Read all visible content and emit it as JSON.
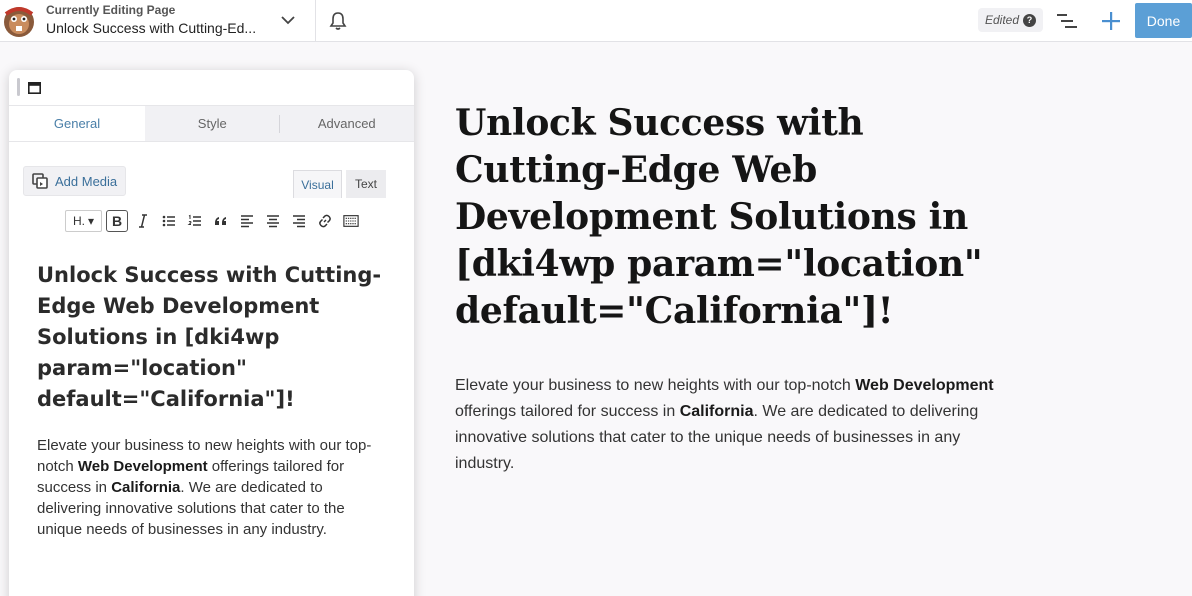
{
  "header": {
    "subtitle": "Currently Editing Page",
    "page_title": "Unlock Success with Cutting-Ed...",
    "edited_label": "Edited",
    "done_label": "Done"
  },
  "panel": {
    "tabs": [
      {
        "label": "General",
        "active": true
      },
      {
        "label": "Style",
        "active": false
      },
      {
        "label": "Advanced",
        "active": false
      }
    ],
    "add_media_label": "Add Media",
    "mode_visual": "Visual",
    "mode_text": "Text",
    "heading_select": "H.",
    "bold_glyph": "B",
    "heading": "Unlock Success with Cutting-Edge Web Development Solutions in [dki4wp param=\"location\" default=\"California\"]!",
    "paragraph": {
      "p1": "Elevate your business to new heights with our top-notch ",
      "b1": "Web Development",
      "p2": " offerings tailored for success in ",
      "b2": "California",
      "p3": ". We are dedicated to delivering innovative solutions that cater to the unique needs of businesses in any industry."
    }
  },
  "preview": {
    "heading": "Unlock Success with Cutting-Edge Web Development Solutions in [dki4wp param=\"location\" default=\"California\"]!",
    "paragraph": {
      "p1": "Elevate your business to new heights with our top-notch ",
      "b1": "Web Development",
      "p2": " offerings tailored for success in ",
      "b2": "California",
      "p3": ". We are dedicated to delivering innovative solutions that cater to the unique needs of businesses in any industry."
    }
  },
  "colors": {
    "accent": "#5b9fd6",
    "tab_active_text": "#4a7fa8",
    "background": "#f9f8fa"
  }
}
